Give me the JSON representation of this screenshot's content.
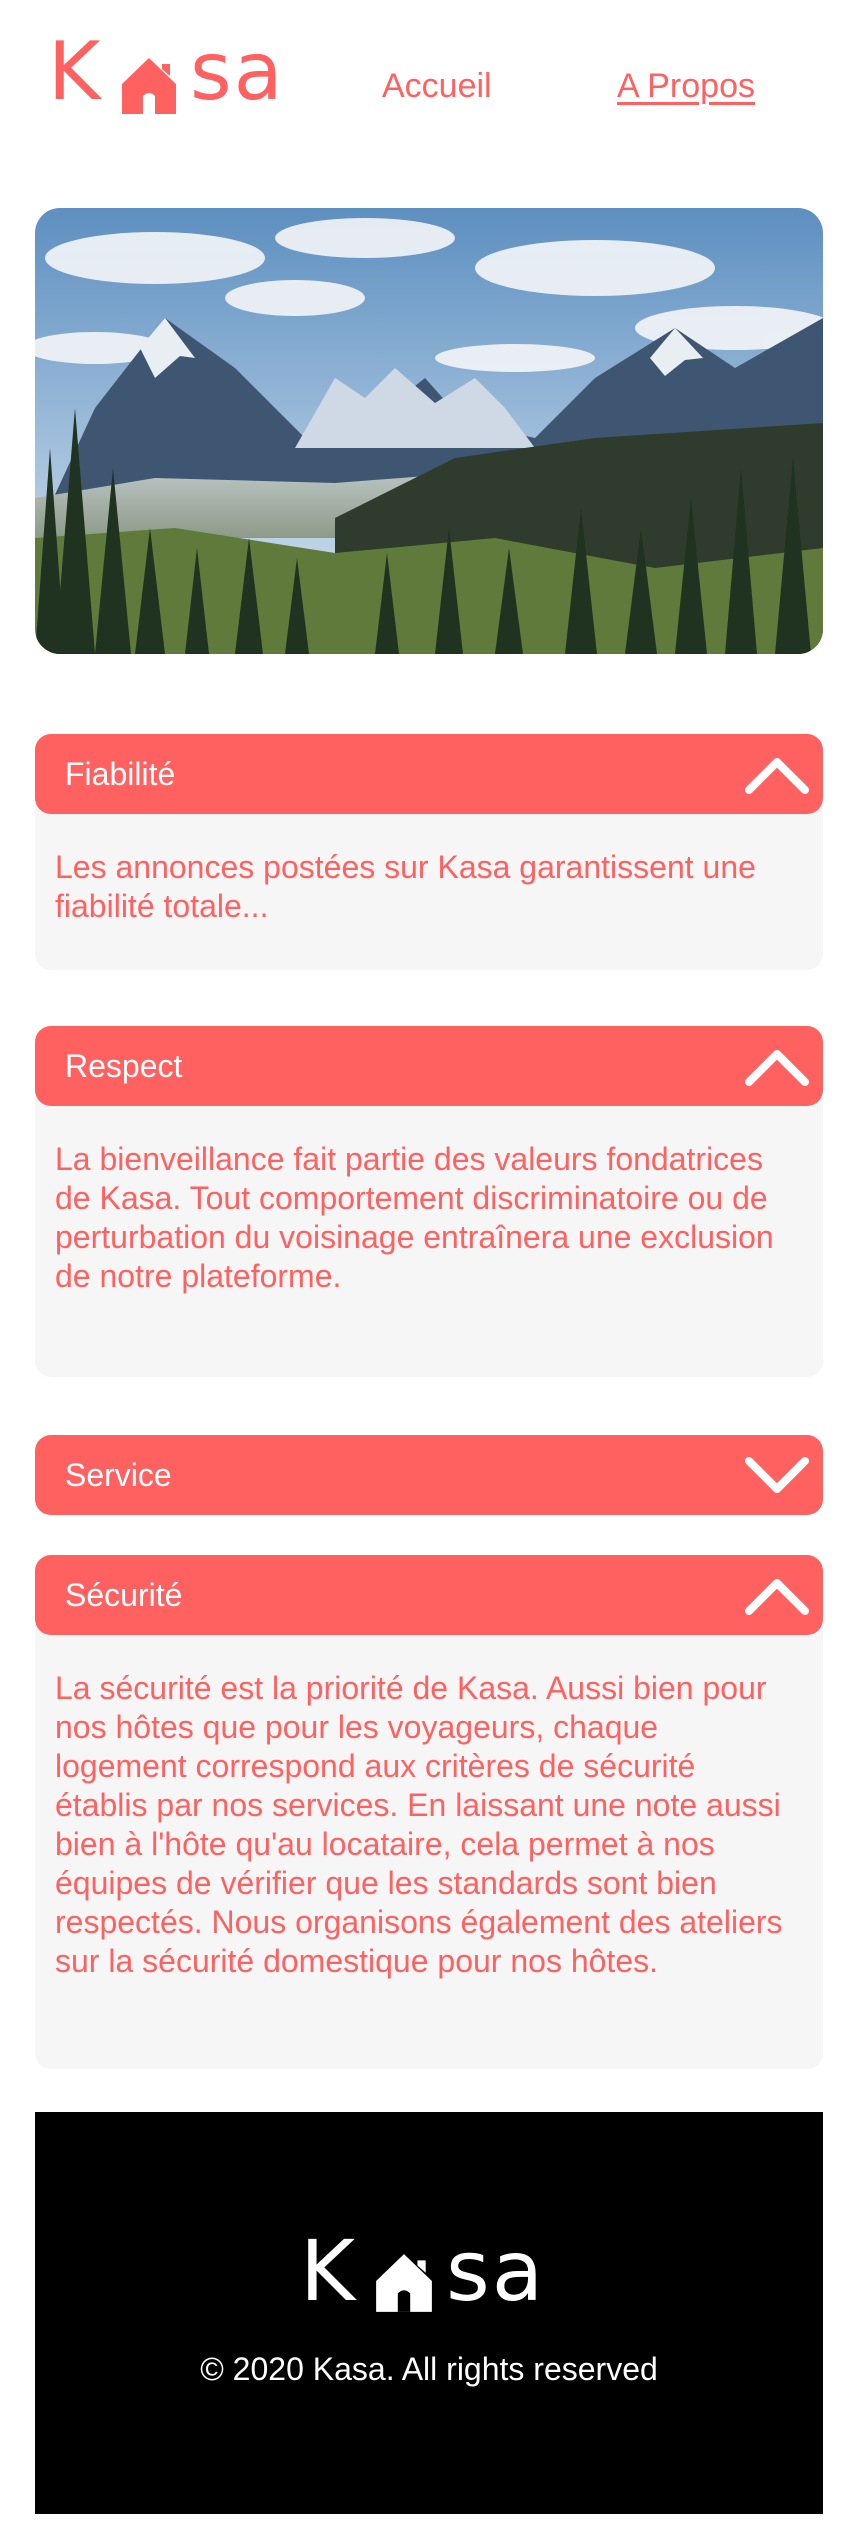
{
  "header": {
    "logo": {
      "letter_k": "K",
      "letters_sa": "sa"
    },
    "nav": {
      "home": "Accueil",
      "about": "A Propos"
    }
  },
  "banner": {
    "image": "mountain-landscape"
  },
  "collapses": [
    {
      "title": "Fiabilité",
      "open": true,
      "text": "Les annonces postées sur Kasa garantissent une fiabilité totale..."
    },
    {
      "title": "Respect",
      "open": true,
      "text": "La bienveillance fait partie des valeurs fondatrices de Kasa. Tout comportement discriminatoire ou de perturbation du voisinage entraînera une exclusion de notre plateforme."
    },
    {
      "title": "Service",
      "open": false,
      "text": ""
    },
    {
      "title": "Sécurité",
      "open": true,
      "text": "La sécurité est la priorité de Kasa. Aussi bien pour nos hôtes que pour les voyageurs, chaque logement correspond aux critères de sécurité établis par nos services. En laissant une note aussi bien à l'hôte qu'au locataire, cela permet à nos équipes de vérifier que les standards sont bien respectés. Nous organisons également des ateliers sur la sécurité domestique pour nos hôtes."
    }
  ],
  "footer": {
    "logo": {
      "letter_k": "K",
      "letters_sa": "sa"
    },
    "copyright": "© 2020 Kasa. All rights reserved"
  },
  "colors": {
    "accent": "#FF6060",
    "panel": "#F6F6F6",
    "footer_bg": "#000000",
    "text_light": "#FFFFFF"
  },
  "icons": {
    "collapse_open": "chevron-up-icon",
    "collapse_closed": "chevron-down-icon",
    "logo_house": "house-icon"
  }
}
